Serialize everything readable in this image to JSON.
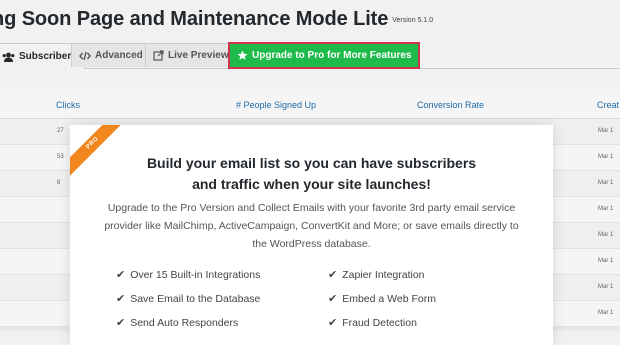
{
  "header": {
    "title": "ng Soon Page and Maintenance Mode Lite",
    "version": "Version 5.1.0"
  },
  "tabs": [
    {
      "label": "Subscribers",
      "icon": "users-icon"
    },
    {
      "label": "Advanced",
      "icon": "code-icon"
    },
    {
      "label": "Live Preview",
      "icon": "external-link-icon"
    },
    {
      "label": "Upgrade to Pro for More Features",
      "icon": "star-icon"
    }
  ],
  "table": {
    "headers": [
      "Clicks",
      "# People Signed Up",
      "Conversion Rate",
      "Creat"
    ],
    "rows": [
      [
        "27",
        "Mar 1"
      ],
      [
        "53",
        "Mar 1"
      ],
      [
        "8",
        "Mar 1"
      ],
      [
        "",
        "Mar 1"
      ],
      [
        "",
        "Mar 1"
      ],
      [
        "",
        "Mar 1"
      ],
      [
        "",
        "Mar 1"
      ],
      [
        "",
        "Mar 1"
      ]
    ]
  },
  "modal": {
    "ribbon": "PRO",
    "heading_line1": "Build your email list so you can have subscribers",
    "heading_line2": "and traffic when your site launches!",
    "body": "Upgrade to the Pro Version and Collect Emails with your favorite 3rd party email service provider like MailChimp, ActiveCampaign, ConvertKit and More; or save emails directly to the WordPress database.",
    "features": [
      "Over 15 Built-in Integrations",
      "Zapier Integration",
      "Save Email to the Database",
      "Embed a Web Form",
      "Send Auto Responders",
      "Fraud Detection"
    ]
  },
  "colors": {
    "pro_tab_bg": "#1fbb4a",
    "pro_tab_border": "#d0334f",
    "ribbon": "#f2861e",
    "link": "#2271b1"
  }
}
